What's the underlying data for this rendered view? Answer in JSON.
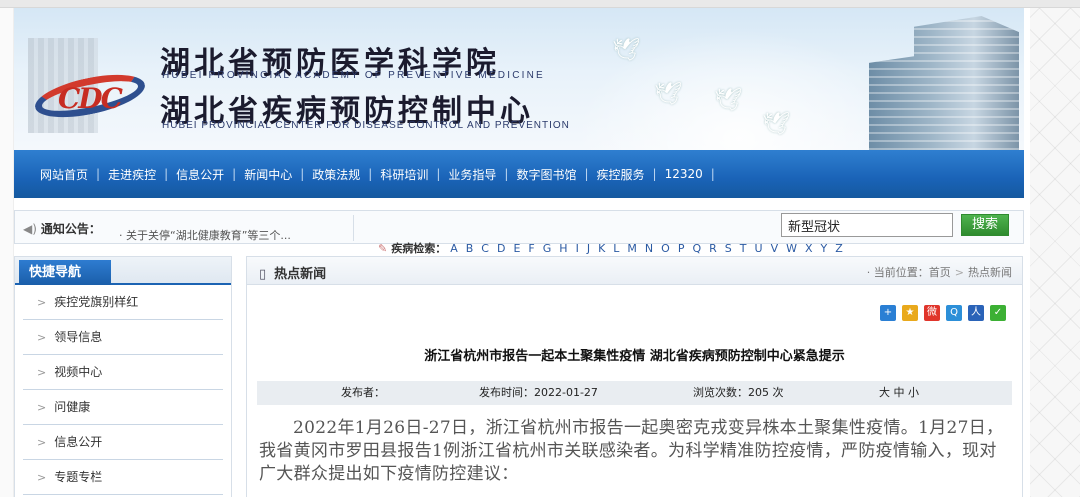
{
  "header": {
    "title_1": "湖北省预防医学科学院",
    "subtitle_1": "HUBEI PROVINCIAL ACADEMY OF PREVENTIVE MEDICINE",
    "title_2": "湖北省疾病预防控制中心",
    "subtitle_2": "HUBEI PROVINCIAL CENTER FOR DISEASE CONTROL AND PREVENTION",
    "logo_text": "CDC"
  },
  "nav": {
    "items": [
      "网站首页",
      "走进疾控",
      "信息公开",
      "新闻中心",
      "政策法规",
      "科研培训",
      "业务指导",
      "数字图书馆",
      "疾控服务",
      "12320"
    ]
  },
  "notice": {
    "label": "通知公告：",
    "text": "· 关于关停“湖北健康教育”等三个...",
    "search_value": "新型冠状",
    "search_button": "搜索"
  },
  "disease_search": {
    "label": "疾病检索：",
    "letters": [
      "A",
      "B",
      "C",
      "D",
      "E",
      "F",
      "G",
      "H",
      "I",
      "J",
      "K",
      "L",
      "M",
      "N",
      "O",
      "P",
      "Q",
      "R",
      "S",
      "T",
      "U",
      "V",
      "W",
      "X",
      "Y",
      "Z"
    ]
  },
  "sidebar": {
    "title": "快捷导航",
    "items": [
      "疾控党旗别样红",
      "领导信息",
      "视频中心",
      "问健康",
      "信息公开",
      "专题专栏"
    ]
  },
  "main": {
    "section_title": "热点新闻",
    "breadcrumb_prefix": "· 当前位置：",
    "breadcrumb_home": "首页",
    "breadcrumb_current": "热点新闻",
    "article_title": "浙江省杭州市报告一起本土聚集性疫情 湖北省疾病预防控制中心紧急提示",
    "meta": {
      "publisher_label": "发布者：",
      "time": "发布时间：2022-01-27",
      "views": "浏览次数：205 次",
      "font_size": "大 中 小"
    },
    "body": "2022年1月26日-27日，浙江省杭州市报告一起奥密克戎变异株本土聚集性疫情。1月27日，我省黄冈市罗田县报告1例浙江省杭州市关联感染者。为科学精准防控疫情，严防疫情输入，现对广大群众提出如下疫情防控建议："
  },
  "share_icons": [
    {
      "name": "plus-share-icon",
      "color": "#2a7fd4"
    },
    {
      "name": "qzone-share-icon",
      "color": "#e9a91c"
    },
    {
      "name": "weibo-share-icon",
      "color": "#e0352b"
    },
    {
      "name": "tencent-share-icon",
      "color": "#2c8fd8"
    },
    {
      "name": "renren-share-icon",
      "color": "#2a63b8"
    },
    {
      "name": "wechat-share-icon",
      "color": "#3cb034"
    }
  ]
}
